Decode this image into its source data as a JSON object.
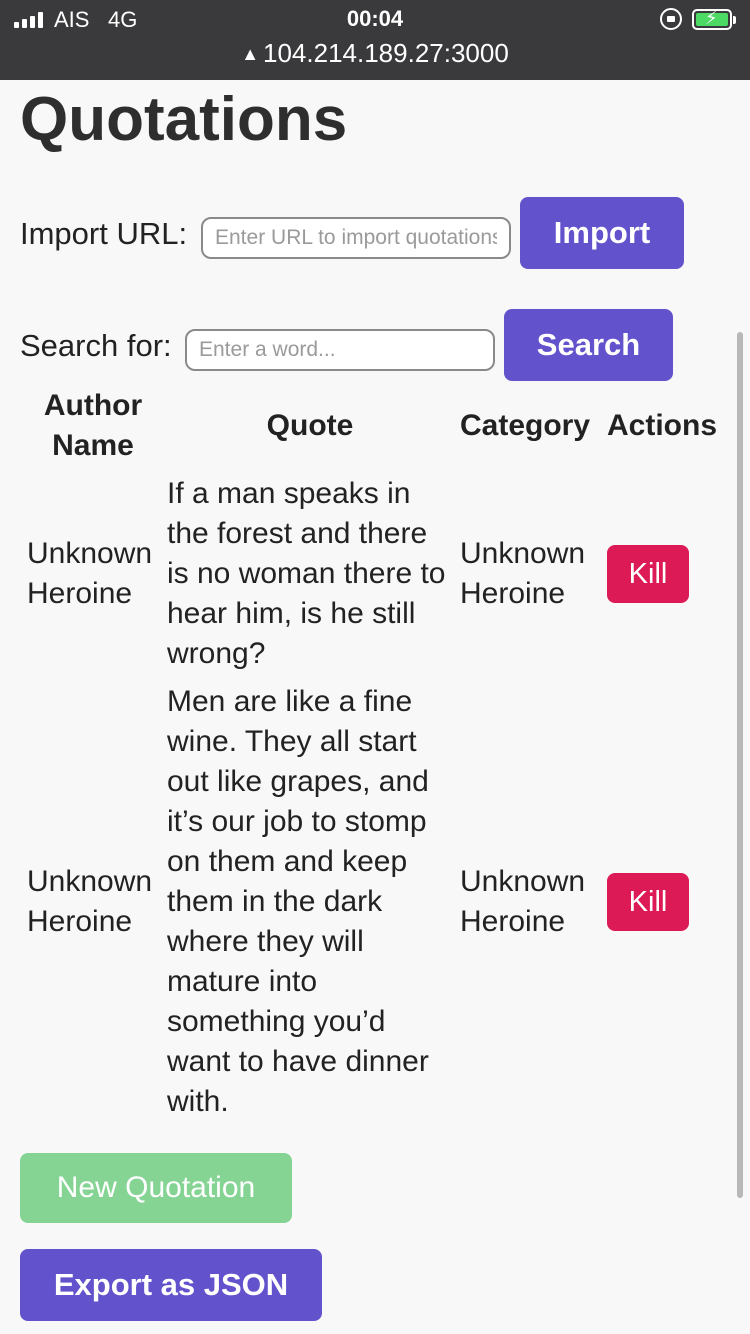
{
  "status_bar": {
    "carrier": "AIS",
    "network": "4G",
    "time": "00:04",
    "url": "104.214.189.27:3000",
    "battery_color": "#4cd964"
  },
  "page": {
    "title": "Quotations"
  },
  "import": {
    "label": "Import URL:",
    "placeholder": "Enter URL to import quotations",
    "button": "Import"
  },
  "search": {
    "label": "Search for:",
    "placeholder": "Enter a word...",
    "button": "Search"
  },
  "table": {
    "headers": {
      "author": "Author Name",
      "quote": "Quote",
      "category": "Category",
      "actions": "Actions"
    },
    "rows": [
      {
        "author": "Unknown Heroine",
        "quote": "If a man speaks in the forest and there is no woman there to hear him, is he still wrong?",
        "category": "Unknown Heroine",
        "action": "Kill"
      },
      {
        "author": "Unknown Heroine",
        "quote": "Men are like a fine wine. They all start out like grapes, and it’s our job to stomp on them and keep them in the dark where they will mature into something you’d want to have dinner with.",
        "category": "Unknown Heroine",
        "action": "Kill"
      }
    ]
  },
  "buttons": {
    "new_quotation": "New Quotation",
    "export": "Export as JSON"
  },
  "colors": {
    "primary": "#6252cc",
    "danger": "#dc1a55",
    "success_disabled": "#86d494"
  }
}
